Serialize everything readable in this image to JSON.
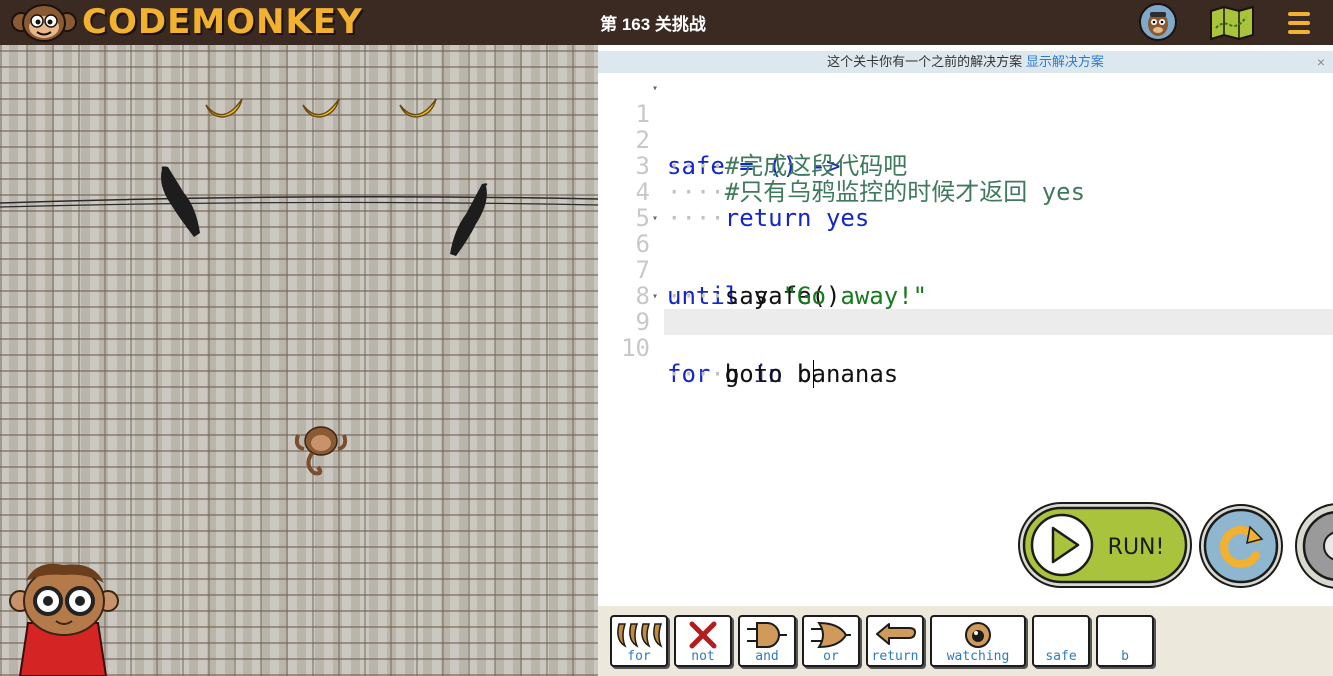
{
  "header": {
    "logo_text": "CODEMONKEY",
    "level_title": "第 163 关挑战",
    "icons": [
      "profile-avatar-icon",
      "map-icon",
      "menu-icon"
    ],
    "accent_color": "#f2b12f",
    "bar_color": "#3a2a22"
  },
  "notice": {
    "text": "这个关卡你有一个之前的解决方案",
    "link": "显示解决方案",
    "close": "×"
  },
  "editor": {
    "lines": [
      {
        "n": "1"
      },
      {
        "n": "2"
      },
      {
        "n": "3"
      },
      {
        "n": "4"
      },
      {
        "n": "5"
      },
      {
        "n": "6"
      },
      {
        "n": "7"
      },
      {
        "n": "8"
      },
      {
        "n": "9"
      },
      {
        "n": "10"
      }
    ],
    "tokens": {
      "l1_a": "safe = () ",
      "l1_b": "->",
      "l2": "#完成这段代码吧",
      "l3": "#只有乌鸦监控的时候才返回 yes",
      "l4_a": "return",
      "l4_b": " yes",
      "l6_a": "until",
      "l6_b": " safe()",
      "l7_a": "say ",
      "l7_b": "\"Go away!\"",
      "l9_a": "for",
      "l9_b": " b ",
      "l9_c": "in",
      "l9_d": " bananas",
      "l10": "goto b",
      "indent": "····"
    }
  },
  "controls": {
    "run_label": "RUN!",
    "run_color": "#a9c43c",
    "reset_color": "#8fb6cf"
  },
  "toolbox": {
    "chips": [
      {
        "label": "for",
        "icon": "bananas-icon"
      },
      {
        "label": "not",
        "icon": "not-x-icon"
      },
      {
        "label": "and",
        "icon": "and-gate-icon"
      },
      {
        "label": "or",
        "icon": "or-gate-icon"
      },
      {
        "label": "return",
        "icon": "return-arrow-icon"
      },
      {
        "label": "watching",
        "icon": "eye-icon"
      },
      {
        "label": "safe",
        "icon": ""
      },
      {
        "label": "b",
        "icon": ""
      }
    ]
  }
}
